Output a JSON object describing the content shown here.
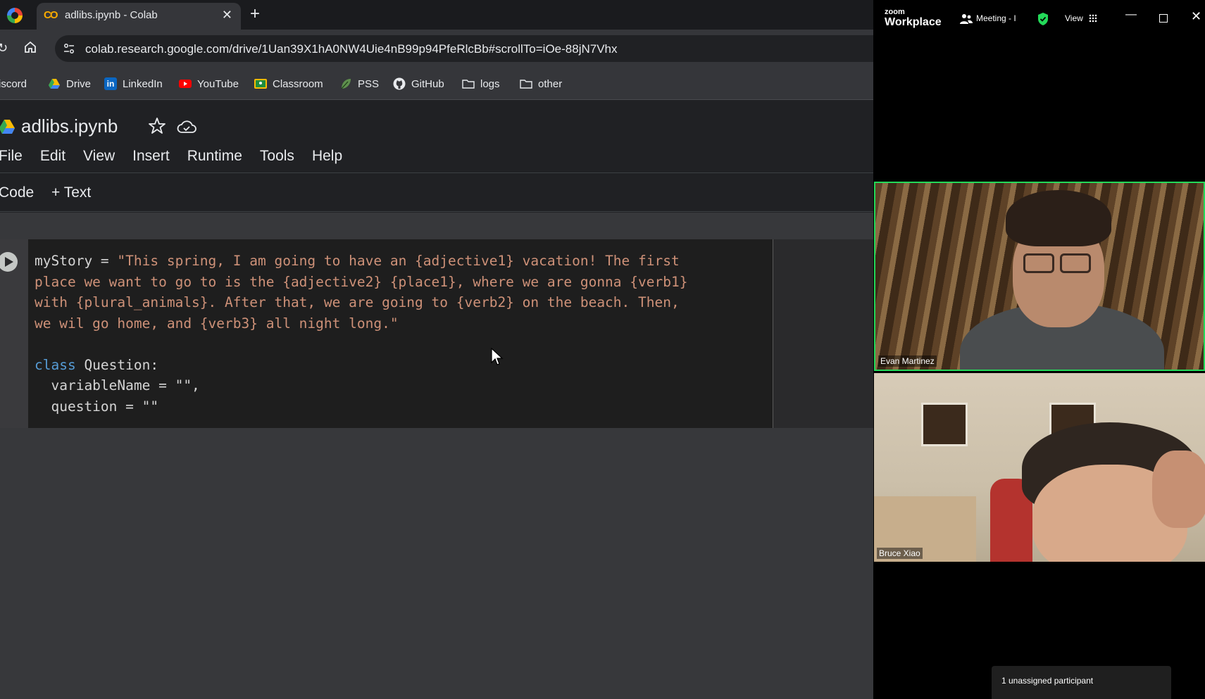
{
  "browser": {
    "tab": {
      "title": "adlibs.ipynb - Colab",
      "favicon": "CO",
      "close": "✕",
      "new_tab": "+"
    },
    "address_bar": {
      "url": "colab.research.google.com/drive/1Uan39X1hA0NW4Uie4nB99p94PfeRlcBb#scrollTo=iOe-88jN7Vhx"
    },
    "bookmarks": [
      {
        "label": "iscord",
        "icon": "discord-icon"
      },
      {
        "label": "Drive",
        "icon": "drive-icon"
      },
      {
        "label": "LinkedIn",
        "icon": "linkedin-icon"
      },
      {
        "label": "YouTube",
        "icon": "youtube-icon"
      },
      {
        "label": "Classroom",
        "icon": "classroom-icon"
      },
      {
        "label": "PSS",
        "icon": "leaf-icon"
      },
      {
        "label": "GitHub",
        "icon": "github-icon"
      },
      {
        "label": "logs",
        "icon": "folder-icon"
      },
      {
        "label": "other",
        "icon": "folder-icon"
      }
    ]
  },
  "colab": {
    "notebook_title": "adlibs.ipynb",
    "menu": [
      "File",
      "Edit",
      "View",
      "Insert",
      "Runtime",
      "Tools",
      "Help"
    ],
    "toolbar": {
      "code": "Code",
      "text": "+ Text"
    },
    "cell": {
      "line1_a": "myStory = ",
      "line1_b": "\"This spring, I am going to have an {adjective1} vacation! The first",
      "line2": "place we want to go to is the {adjective2} {place1}, where we are gonna {verb1}",
      "line3": "with {plural_animals}. After that, we are going to {verb2} on the beach. Then,",
      "line4": "we wil go home, and {verb3} all night long.\"",
      "line6_kw": "class",
      "line6_rest": " Question:",
      "line7": "  variableName = \"\",",
      "line8": "  question = \"\""
    }
  },
  "zoom": {
    "logo_top": "zoom",
    "logo_bottom": "Workplace",
    "meeting_label": "Meeting - I",
    "view_label": "View",
    "participants": [
      {
        "name": "Evan Martinez",
        "active_speaker": true
      },
      {
        "name": "Bruce Xiao",
        "active_speaker": false
      }
    ],
    "unassigned": "1 unassigned participant"
  },
  "colors": {
    "active_speaker_border": "#23d959",
    "colab_orange": "#f9ab00",
    "string": "#ce9178",
    "keyword": "#569cd6"
  }
}
